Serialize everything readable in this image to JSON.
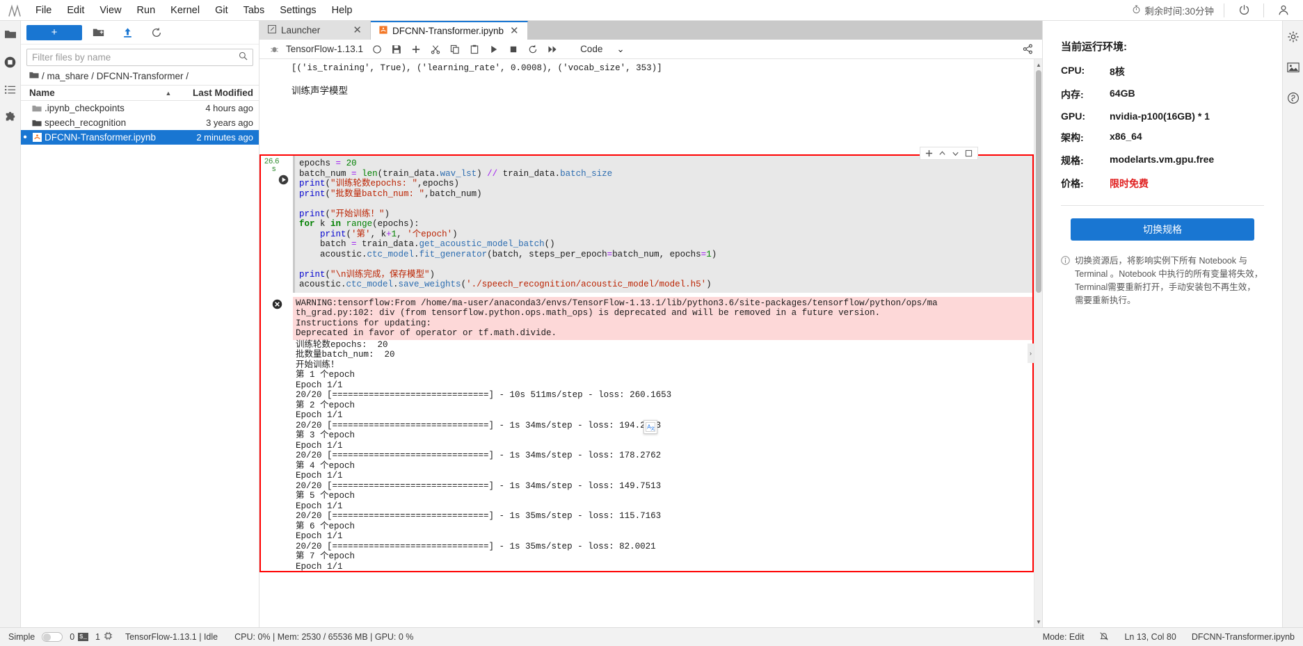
{
  "menubar": {
    "logo": "jupyter-logo",
    "items": [
      "File",
      "Edit",
      "View",
      "Run",
      "Kernel",
      "Git",
      "Tabs",
      "Settings",
      "Help"
    ],
    "timer_label": "剩余时间:30分钟",
    "power_icon": "power-icon",
    "account_icon": "account-icon"
  },
  "left_activitybar": {
    "items": [
      {
        "name": "file-browser-icon",
        "glyph": "folder"
      },
      {
        "name": "running-terminals-icon",
        "glyph": "stop"
      },
      {
        "name": "commands-icon",
        "glyph": "list"
      },
      {
        "name": "extensions-icon",
        "glyph": "puzzle"
      }
    ]
  },
  "filebrowser": {
    "new_button_label": "+",
    "toolbar_icons": [
      "new-folder-icon",
      "upload-icon",
      "refresh-icon"
    ],
    "filter_placeholder": "Filter files by name",
    "filter_value": "",
    "breadcrumb": "/ ma_share / DFCNN-Transformer /",
    "columns": [
      "Name",
      "Last Modified"
    ],
    "sort_indicator": "▲",
    "rows": [
      {
        "name": ".ipynb_checkpoints",
        "modified": "4 hours ago",
        "type": "folder",
        "selected": false,
        "dirty": false
      },
      {
        "name": "speech_recognition",
        "modified": "3 years ago",
        "type": "folder",
        "selected": false,
        "dirty": false
      },
      {
        "name": "DFCNN-Transformer.ipynb",
        "modified": "2 minutes ago",
        "type": "notebook",
        "selected": true,
        "dirty": true
      }
    ]
  },
  "tabs": [
    {
      "label": "Launcher",
      "icon": "launcher-icon",
      "active": false,
      "closable": true
    },
    {
      "label": "DFCNN-Transformer.ipynb",
      "icon": "notebook-icon",
      "active": true,
      "closable": true
    }
  ],
  "notebook_toolbar": {
    "kernel_bug_icon": "debug-icon",
    "kernel_name": "TensorFlow-1.13.1",
    "kernel_status_icon": "circle-idle-icon",
    "buttons": [
      {
        "name": "save-button",
        "glyph": "save"
      },
      {
        "name": "insert-cell-button",
        "glyph": "plus"
      },
      {
        "name": "cut-cell-button",
        "glyph": "scissors"
      },
      {
        "name": "copy-cell-button",
        "glyph": "copy"
      },
      {
        "name": "paste-cell-button",
        "glyph": "clipboard"
      },
      {
        "name": "run-cell-button",
        "glyph": "play"
      },
      {
        "name": "interrupt-kernel-button",
        "glyph": "stop"
      },
      {
        "name": "restart-kernel-button",
        "glyph": "refresh"
      },
      {
        "name": "restart-run-all-button",
        "glyph": "fast-forward"
      }
    ],
    "celltype_value": "Code",
    "celltype_caret": "⌄",
    "share_icon": "share-icon"
  },
  "notebook": {
    "above_cell_code": "[('is_training', True), ('learning_rate', 0.0008), ('vocab_size', 353)]",
    "markdown_heading": "训练声学模型",
    "cell_toolbar": [
      "add-cell-icon",
      "move-up-icon",
      "move-down-icon",
      "delete-cell-icon"
    ],
    "prompt_time": "26.6",
    "prompt_unit": "s",
    "code_lines": [
      "epochs = 20",
      "batch_num = len(train_data.wav_lst) // train_data.batch_size",
      "print(\"训练轮数epochs: \",epochs)",
      "print(\"批数量batch_num: \",batch_num)",
      "",
      "print(\"开始训练！\")",
      "for k in range(epochs):",
      "    print('第', k+1, '个epoch')",
      "    batch = train_data.get_acoustic_model_batch()",
      "    acoustic.ctc_model.fit_generator(batch, steps_per_epoch=batch_num, epochs=1)",
      "",
      "print(\"\\n训练完成，保存模型\")",
      "acoustic.ctc_model.save_weights('./speech_recognition/acoustic_model/model.h5')"
    ],
    "output_error_icon": "error-x-icon",
    "warning_lines": [
      "WARNING:tensorflow:From /home/ma-user/anaconda3/envs/TensorFlow-1.13.1/lib/python3.6/site-packages/tensorflow/python/ops/ma",
      "th_grad.py:102: div (from tensorflow.python.ops.math_ops) is deprecated and will be removed in a future version.",
      "Instructions for updating:",
      "Deprecated in favor of operator or tf.math.divide."
    ],
    "stdout_lines": [
      "训练轮数epochs:  20",
      "批数量batch_num:  20",
      "开始训练！",
      "第 1 个epoch",
      "Epoch 1/1",
      "20/20 [==============================] - 10s 511ms/step - loss: 260.1653",
      "第 2 个epoch",
      "Epoch 1/1",
      "20/20 [==============================] - 1s 34ms/step - loss: 194.2883",
      "第 3 个epoch",
      "Epoch 1/1",
      "20/20 [==============================] - 1s 34ms/step - loss: 178.2762",
      "第 4 个epoch",
      "Epoch 1/1",
      "20/20 [==============================] - 1s 34ms/step - loss: 149.7513",
      "第 5 个epoch",
      "Epoch 1/1",
      "20/20 [==============================] - 1s 35ms/step - loss: 115.7163",
      "第 6 个epoch",
      "Epoch 1/1",
      "20/20 [==============================] - 1s 35ms/step - loss: 82.0021",
      "第 7 个epoch",
      "Epoch 1/1"
    ],
    "translate_icon": "translate-icon"
  },
  "right_panel": {
    "title": "当前运行环境:",
    "specs": [
      {
        "key": "CPU:",
        "value": "8核",
        "highlight": false
      },
      {
        "key": "内存:",
        "value": "64GB",
        "highlight": false
      },
      {
        "key": "GPU:",
        "value": "nvidia-p100(16GB) * 1",
        "highlight": false
      },
      {
        "key": "架构:",
        "value": "x86_64",
        "highlight": false
      },
      {
        "key": "规格:",
        "value": "modelarts.vm.gpu.free",
        "highlight": false
      },
      {
        "key": "价格:",
        "value": "限时免费",
        "highlight": true
      }
    ],
    "switch_button_label": "切换规格",
    "note_icon": "info-icon",
    "note": "切换资源后，将影响实例下所有 Notebook 与 Terminal 。Notebook 中执行的所有变量将失效，Terminal需要重新打开，手动安装包不再生效，需要重新执行。"
  },
  "right_activitybar": {
    "items": [
      {
        "name": "settings-gear-icon",
        "glyph": "gear"
      },
      {
        "name": "image-panel-icon",
        "glyph": "image"
      },
      {
        "name": "help-circle-icon",
        "glyph": "circle"
      }
    ]
  },
  "statusbar": {
    "mode_label": "Simple",
    "terminal_count": "0",
    "terminal_icon": "terminal-icon",
    "kernel_count": "1",
    "kernel_icon": "kernel-icon",
    "kernel_status": "TensorFlow-1.13.1 | Idle",
    "resources": "CPU: 0% | Mem: 2530 / 65536 MB | GPU: 0 %",
    "mode": "Mode: Edit",
    "notifications_icon": "bell-off-icon",
    "cursor_position": "Ln 13, Col 80",
    "filename": "DFCNN-Transformer.ipynb"
  },
  "colors": {
    "accent": "#1976d2",
    "selected_cell_outline": "#ff0000",
    "warning_bg": "#fdd8d8",
    "price_highlight": "#e02020"
  }
}
